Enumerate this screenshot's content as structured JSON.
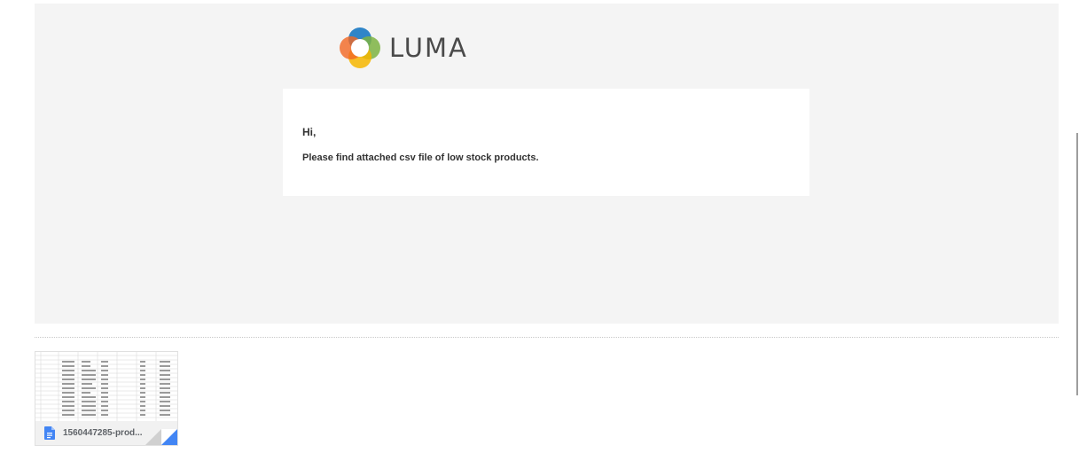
{
  "email": {
    "brand": "LUMA",
    "greeting": "Hi,",
    "message": "Please find attached csv file of low stock products."
  },
  "attachment": {
    "filename": "1560447285-prod...",
    "type_icon": "document-icon"
  },
  "colors": {
    "frame_bg": "#f4f4f4",
    "logo_blue": "#1979c3",
    "logo_green": "#4caf50",
    "logo_yellow": "#f6b600",
    "logo_orange": "#f26722",
    "doc_icon": "#4285f4"
  }
}
